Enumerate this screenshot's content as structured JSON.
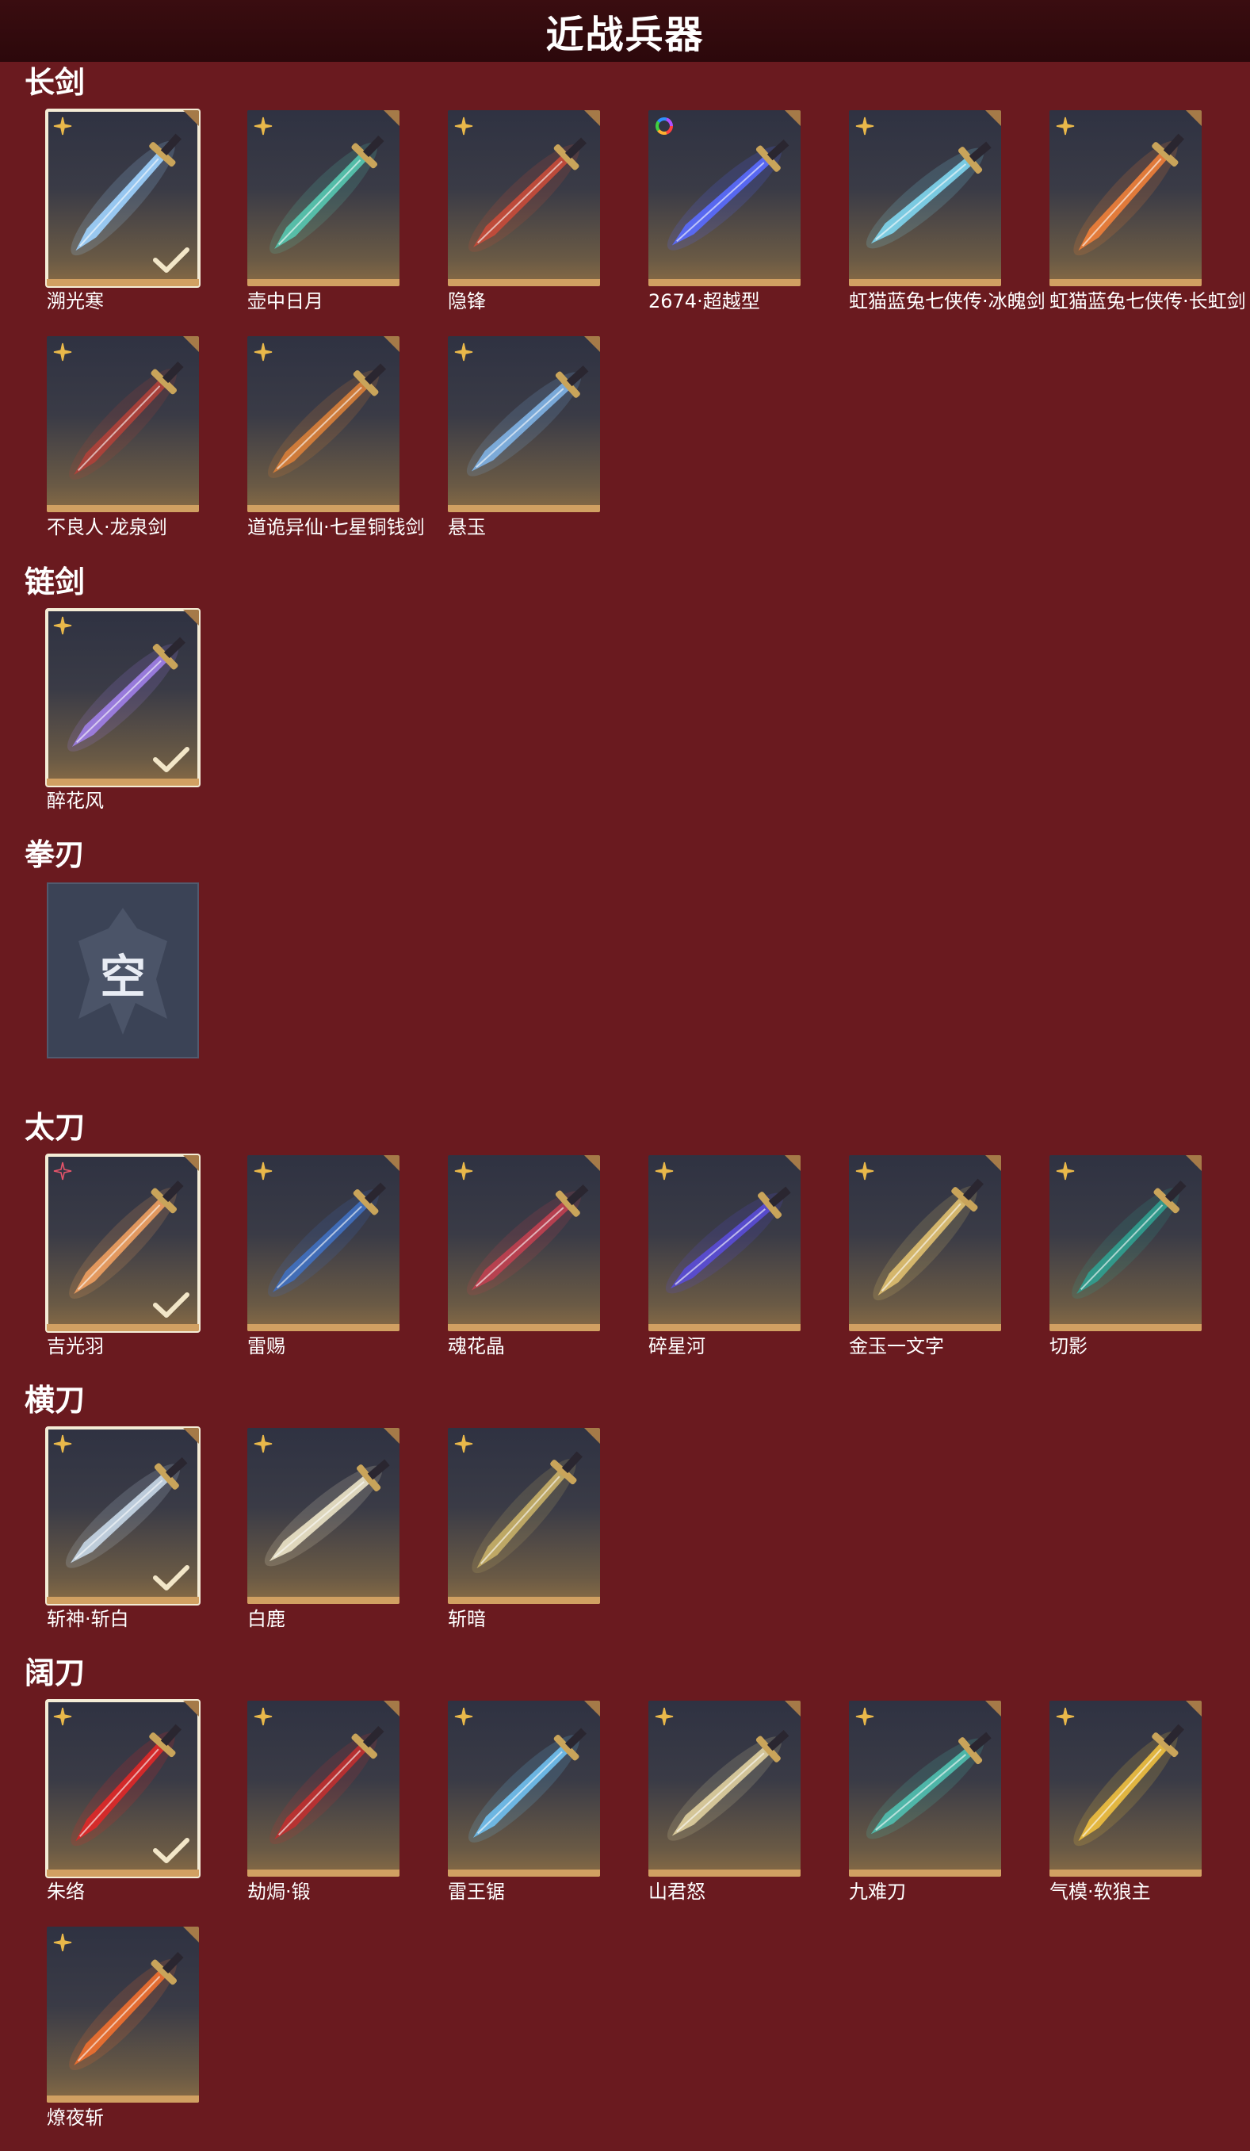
{
  "header": {
    "title": "近战兵器"
  },
  "colors": {
    "background": "#6a1a1f",
    "header_bg": "#2c080b",
    "card_base": "#d1a062",
    "selected_border": "#f4ecd6",
    "rarity_gold": "#e9b84a",
    "rarity_red": "#e8546a"
  },
  "sections": [
    {
      "title": "长剑",
      "items": [
        {
          "name": "溯光寒",
          "selected": true,
          "rarity": "gold-star-icon",
          "art_color": "#9fd3ff"
        },
        {
          "name": "壶中日月",
          "selected": false,
          "rarity": "gold-star-icon",
          "art_color": "#57c8b0"
        },
        {
          "name": "隐锋",
          "selected": false,
          "rarity": "gold-star-icon",
          "art_color": "#c84b3a"
        },
        {
          "name": "2674·超越型",
          "selected": false,
          "rarity": "rainbow-ring-icon",
          "art_color": "#5a6cff"
        },
        {
          "name": "虹猫蓝兔七侠传·冰魄剑",
          "selected": false,
          "rarity": "gold-star-icon",
          "art_color": "#7fd6ee"
        },
        {
          "name": "虹猫蓝兔七侠传·长虹剑",
          "selected": false,
          "rarity": "gold-star-icon",
          "art_color": "#f0803a"
        },
        {
          "name": "不良人·龙泉剑",
          "selected": false,
          "rarity": "gold-star-icon",
          "art_color": "#b0413a"
        },
        {
          "name": "道诡异仙·七星铜钱剑",
          "selected": false,
          "rarity": "gold-star-icon",
          "art_color": "#d9803a"
        },
        {
          "name": "悬玉",
          "selected": false,
          "rarity": "gold-star-icon",
          "art_color": "#7fb2e6"
        }
      ]
    },
    {
      "title": "链剑",
      "items": [
        {
          "name": "醉花风",
          "selected": true,
          "rarity": "gold-star-icon",
          "art_color": "#a080e8"
        }
      ]
    },
    {
      "title": "拳刃",
      "items": [],
      "empty_text": "空"
    },
    {
      "title": "太刀",
      "items": [
        {
          "name": "吉光羽",
          "selected": true,
          "rarity": "red-star-icon",
          "art_color": "#f0a060"
        },
        {
          "name": "雷赐",
          "selected": false,
          "rarity": "gold-star-icon",
          "art_color": "#4070c0"
        },
        {
          "name": "魂花晶",
          "selected": false,
          "rarity": "gold-star-icon",
          "art_color": "#c04050"
        },
        {
          "name": "碎星河",
          "selected": false,
          "rarity": "gold-star-icon",
          "art_color": "#5a4cd8"
        },
        {
          "name": "金玉一文字",
          "selected": false,
          "rarity": "gold-star-icon",
          "art_color": "#e0c070"
        },
        {
          "name": "切影",
          "selected": false,
          "rarity": "gold-star-icon",
          "art_color": "#30a090"
        }
      ]
    },
    {
      "title": "横刀",
      "items": [
        {
          "name": "斩神·斩白",
          "selected": true,
          "rarity": "gold-star-icon",
          "art_color": "#c8d8e8"
        },
        {
          "name": "白鹿",
          "selected": false,
          "rarity": "gold-star-icon",
          "art_color": "#ece4c8"
        },
        {
          "name": "斩暗",
          "selected": false,
          "rarity": "gold-star-icon",
          "art_color": "#c8b068"
        }
      ]
    },
    {
      "title": "阔刀",
      "items": [
        {
          "name": "朱络",
          "selected": true,
          "rarity": "gold-star-icon",
          "art_color": "#e02828"
        },
        {
          "name": "劫焗·锻",
          "selected": false,
          "rarity": "gold-star-icon",
          "art_color": "#c03030"
        },
        {
          "name": "雷王锯",
          "selected": false,
          "rarity": "gold-star-icon",
          "art_color": "#70c0f0"
        },
        {
          "name": "山君怒",
          "selected": false,
          "rarity": "gold-star-icon",
          "art_color": "#e0d0a0"
        },
        {
          "name": "九难刀",
          "selected": false,
          "rarity": "gold-star-icon",
          "art_color": "#50c0b0"
        },
        {
          "name": "气模·软狼主",
          "selected": false,
          "rarity": "gold-star-icon",
          "art_color": "#f0c040"
        },
        {
          "name": "燎夜斩",
          "selected": false,
          "rarity": "gold-star-icon",
          "art_color": "#f07030"
        }
      ]
    }
  ]
}
